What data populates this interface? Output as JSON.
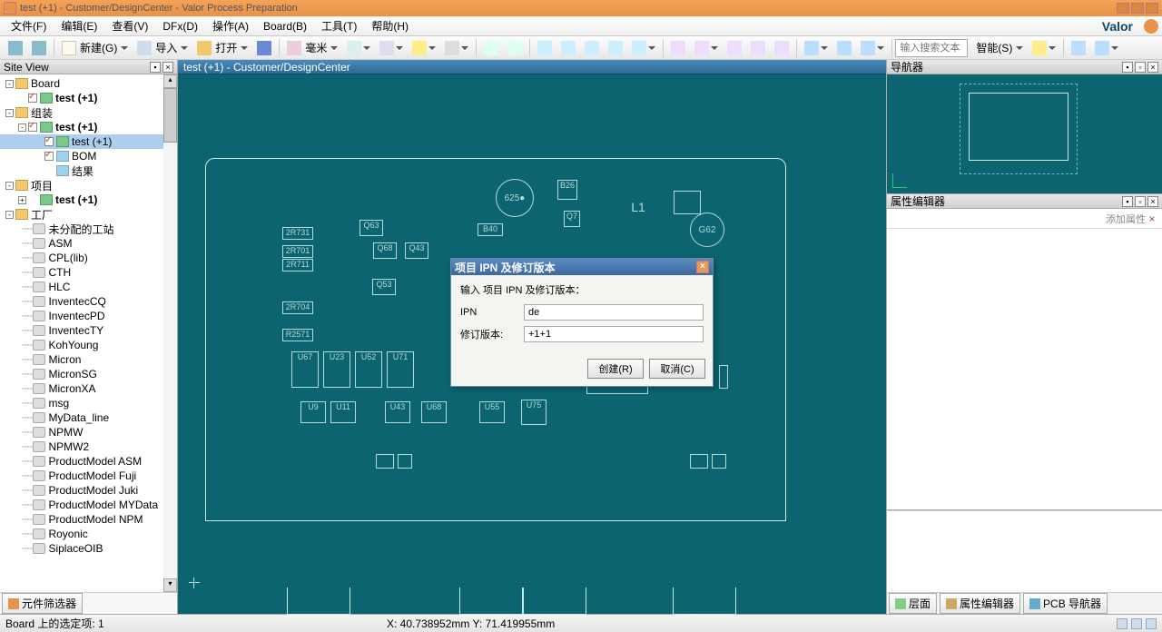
{
  "title": "test (+1) - Customer/DesignCenter - Valor Process Preparation",
  "brand": "Valor",
  "menu": [
    "文件(F)",
    "编辑(E)",
    "查看(V)",
    "DFx(D)",
    "操作(A)",
    "Board(B)",
    "工具(T)",
    "帮助(H)"
  ],
  "toolbar": {
    "new_label": "新建(G)",
    "import_label": "导入",
    "open_label": "打开",
    "unit_label": "毫米",
    "search_placeholder": "输入搜索文本",
    "smart_label": "智能(S)"
  },
  "left": {
    "header": "Site View",
    "filter_btn": "元件筛选器",
    "tree": {
      "board": "Board",
      "test1": "test (+1)",
      "assembly": "组装",
      "test2": "test (+1)",
      "test3": "test (+1)",
      "bom": "BOM",
      "result": "结果",
      "project": "项目",
      "test4": "test (+1)",
      "factory": "工厂",
      "items": [
        "未分配的工站",
        "ASM",
        "CPL(lib)",
        "CTH",
        "HLC",
        "InventecCQ",
        "InventecPD",
        "InventecTY",
        "KohYoung",
        "Micron",
        "MicronSG",
        "MicronXA",
        "msg",
        "MyData_line",
        "NPMW",
        "NPMW2",
        "ProductModel ASM",
        "ProductModel Fuji",
        "ProductModel Juki",
        "ProductModel MYData",
        "ProductModel NPM",
        "Royonic",
        "SiplaceOIB"
      ]
    }
  },
  "center": {
    "tab": "test (+1) - Customer/DesignCenter"
  },
  "right": {
    "nav_header": "导航器",
    "prop_header": "属性编辑器",
    "add_prop": "添加属性",
    "tabs": {
      "layer": "层面",
      "prop": "属性编辑器",
      "pcb": "PCB 导航器"
    }
  },
  "modal": {
    "title": "项目 IPN 及修订版本",
    "message": "输入 项目 IPN 及修订版本：",
    "ipn_label": "IPN",
    "ipn_value": "de",
    "rev_label": "修订版本:",
    "rev_value": "+1+1",
    "create": "创建(R)",
    "cancel": "取消(C)"
  },
  "status": {
    "left": "Board 上的选定项: 1",
    "center": "X: 40.738952mm Y: 71.419955mm"
  }
}
